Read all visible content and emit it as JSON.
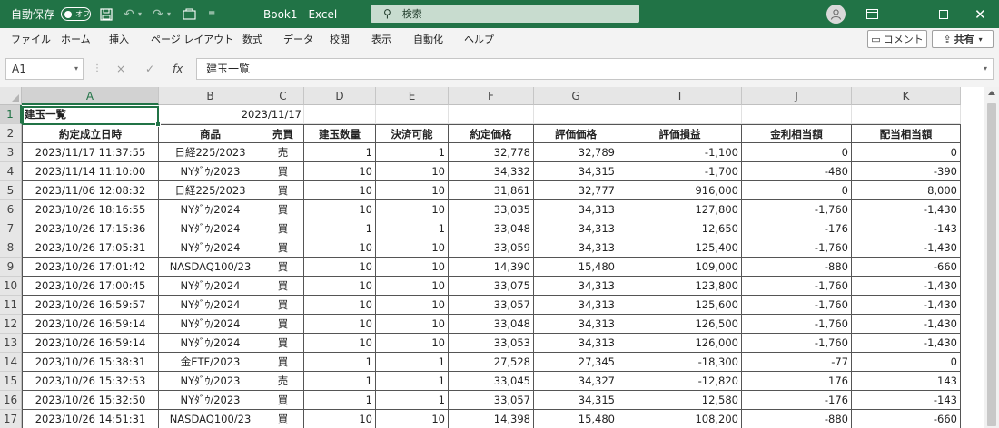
{
  "titlebar": {
    "autosave_label": "自動保存",
    "autosave_state": "オフ",
    "doc_title": "Book1  -  Excel",
    "search_placeholder": "検索"
  },
  "menu": {
    "items": [
      "ファイル",
      "ホーム",
      "挿入",
      "ページ レイアウト",
      "数式",
      "データ",
      "校閲",
      "表示",
      "自動化",
      "ヘルプ"
    ],
    "comment_label": "コメント",
    "share_label": "共有"
  },
  "formula_bar": {
    "name_box": "A1",
    "cancel_symbol": "×",
    "enter_symbol": "✓",
    "fx_symbol": "fx",
    "formula": "建玉一覧"
  },
  "grid": {
    "columns": [
      "A",
      "B",
      "C",
      "D",
      "E",
      "F",
      "G",
      "I",
      "J",
      "K"
    ],
    "rows": [
      "1",
      "2",
      "3",
      "4",
      "5",
      "6",
      "7",
      "8",
      "9",
      "10",
      "11",
      "12",
      "13",
      "14",
      "15",
      "16",
      "17"
    ],
    "title_cell": "建玉一覧",
    "date_cell": "2023/11/17",
    "headers": [
      "約定成立日時",
      "商品",
      "売買",
      "建玉数量",
      "決済可能",
      "約定価格",
      "評価価格",
      "評価損益",
      "金利相当額",
      "配当相当額"
    ],
    "data": [
      [
        "2023/11/17 11:37:55",
        "日経225/2023",
        "売",
        "1",
        "1",
        "32,778",
        "32,789",
        "-1,100",
        "0",
        "0"
      ],
      [
        "2023/11/14 11:10:00",
        "NYﾀﾞｳ/2023",
        "買",
        "10",
        "10",
        "34,332",
        "34,315",
        "-1,700",
        "-480",
        "-390"
      ],
      [
        "2023/11/06 12:08:32",
        "日経225/2023",
        "買",
        "10",
        "10",
        "31,861",
        "32,777",
        "916,000",
        "0",
        "8,000"
      ],
      [
        "2023/10/26 18:16:55",
        "NYﾀﾞｳ/2024",
        "買",
        "10",
        "10",
        "33,035",
        "34,313",
        "127,800",
        "-1,760",
        "-1,430"
      ],
      [
        "2023/10/26 17:15:36",
        "NYﾀﾞｳ/2024",
        "買",
        "1",
        "1",
        "33,048",
        "34,313",
        "12,650",
        "-176",
        "-143"
      ],
      [
        "2023/10/26 17:05:31",
        "NYﾀﾞｳ/2024",
        "買",
        "10",
        "10",
        "33,059",
        "34,313",
        "125,400",
        "-1,760",
        "-1,430"
      ],
      [
        "2023/10/26 17:01:42",
        "NASDAQ100/23",
        "買",
        "10",
        "10",
        "14,390",
        "15,480",
        "109,000",
        "-880",
        "-660"
      ],
      [
        "2023/10/26 17:00:45",
        "NYﾀﾞｳ/2024",
        "買",
        "10",
        "10",
        "33,075",
        "34,313",
        "123,800",
        "-1,760",
        "-1,430"
      ],
      [
        "2023/10/26 16:59:57",
        "NYﾀﾞｳ/2024",
        "買",
        "10",
        "10",
        "33,057",
        "34,313",
        "125,600",
        "-1,760",
        "-1,430"
      ],
      [
        "2023/10/26 16:59:14",
        "NYﾀﾞｳ/2024",
        "買",
        "10",
        "10",
        "33,048",
        "34,313",
        "126,500",
        "-1,760",
        "-1,430"
      ],
      [
        "2023/10/26 16:59:14",
        "NYﾀﾞｳ/2024",
        "買",
        "10",
        "10",
        "33,053",
        "34,313",
        "126,000",
        "-1,760",
        "-1,430"
      ],
      [
        "2023/10/26 15:38:31",
        "金ETF/2023",
        "買",
        "1",
        "1",
        "27,528",
        "27,345",
        "-18,300",
        "-77",
        "0"
      ],
      [
        "2023/10/26 15:32:53",
        "NYﾀﾞｳ/2023",
        "売",
        "1",
        "1",
        "33,045",
        "34,327",
        "-12,820",
        "176",
        "143"
      ],
      [
        "2023/10/26 15:32:50",
        "NYﾀﾞｳ/2023",
        "買",
        "1",
        "1",
        "33,057",
        "34,315",
        "12,580",
        "-176",
        "-143"
      ],
      [
        "2023/10/26 14:51:31",
        "NASDAQ100/23",
        "買",
        "10",
        "10",
        "14,398",
        "15,480",
        "108,200",
        "-880",
        "-660"
      ]
    ]
  }
}
